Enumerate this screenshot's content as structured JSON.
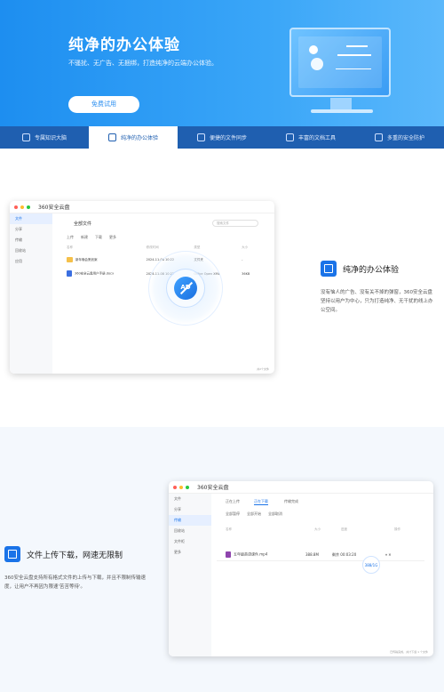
{
  "hero": {
    "title": "纯净的办公体验",
    "subtitle": "不骚扰、无广告、无捆绑，打造纯净的云端办公体验。",
    "cta": "免费试用"
  },
  "tabs": [
    {
      "label": "专属知识大脑",
      "active": false
    },
    {
      "label": "纯净的办公体验",
      "active": true
    },
    {
      "label": "便捷的文件同步",
      "active": false
    },
    {
      "label": "丰富的文档工具",
      "active": false
    },
    {
      "label": "多重的安全防护",
      "active": false
    }
  ],
  "app1": {
    "brand": "360安全云盘",
    "sidebar": [
      "文件",
      "分享",
      "传输",
      "回收站",
      "应用"
    ],
    "crumb": "全部文件",
    "search_placeholder": "搜索文件",
    "toolbar": [
      "上传",
      "新建",
      "下载",
      "更多"
    ],
    "columns": [
      "名称",
      "修改时间",
      "类型",
      "大小"
    ],
    "rows": [
      {
        "name": "新年晚会策划案",
        "time": "2024-11-08 10:22",
        "type": "文件夹",
        "size": "-"
      },
      {
        "name": "360安全云盘用户手册.docx",
        "time": "2024-11-08 10:22",
        "type": "Office Open XML",
        "size": "36KB"
      }
    ],
    "badge": "AD",
    "status": "共2个文件"
  },
  "feature1": {
    "title": "纯净的办公体验",
    "desc": "没有恼人的广告、没有关不掉的弹窗，360安全云盘坚持以用户为中心，只为打造纯净、无干扰的线上办公空间。"
  },
  "app2": {
    "brand": "360安全云盘",
    "sidebar": [
      "文件",
      "分享",
      "传输",
      "回收站",
      "文件柜",
      "更多"
    ],
    "tabs": [
      "正在上传",
      "正在下载",
      "传输完成"
    ],
    "actions": [
      "全部暂停",
      "全部开始",
      "全部取消"
    ],
    "columns": [
      "名称",
      "大小",
      "进度",
      "操作"
    ],
    "row": {
      "name": "五年级英语课件.mp4",
      "size": "388.8M",
      "eta": "剩余 00:03:20"
    },
    "progress_label": "388/1G",
    "status": "已传输完成，共计下载 1 个文件"
  },
  "feature2": {
    "title": "文件上传下载，网速无限制",
    "desc": "360安全云盘支持所有格式文件的上传与下载，并且不限制传输速度，让用户不再因为限速'苦苦等待'。"
  }
}
